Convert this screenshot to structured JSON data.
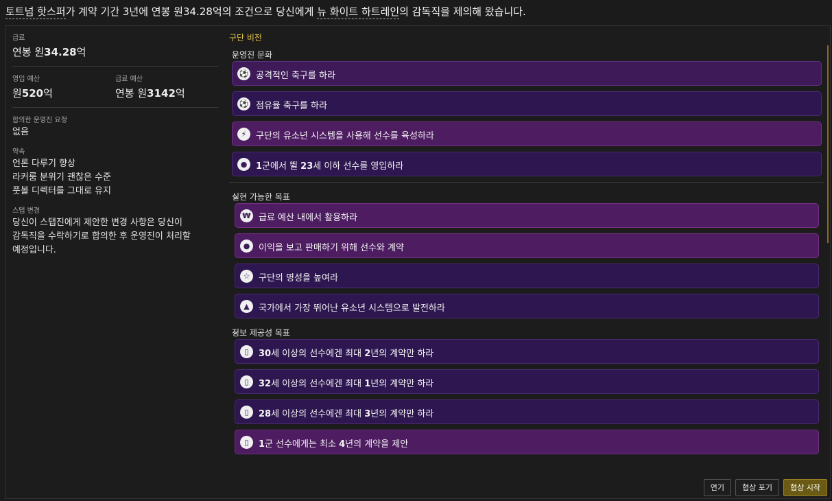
{
  "headline": {
    "club": "토트넘 핫스퍼",
    "part1": "가 계약 기간 3년에 연봉 원34.28억의 조건으로 당신에게 ",
    "team": "뉴 화이트 하트레인",
    "part2": "의 감독직을 제의해 왔습니다."
  },
  "left": {
    "salary_label": "급료",
    "salary_prefix": "연봉 원",
    "salary_value": "34.28",
    "salary_suffix": "억",
    "transfer_label": "영입 예산",
    "transfer_prefix": "원",
    "transfer_value": "520",
    "transfer_suffix": "억",
    "wage_label": "급료 예산",
    "wage_prefix": "연봉 원",
    "wage_value": "3142",
    "wage_suffix": "억",
    "board_req_label": "합의한 운영진 요청",
    "board_req_value": "없음",
    "promises_label": "약속",
    "promises": [
      "언론 다루기 향상",
      "라커룸 분위기 괜찮은 수준",
      "풋볼 디렉터를 그대로 유지"
    ],
    "staff_label": "스탭 변경",
    "staff_text_1": "당신이 스탭진에게 제안한 변경 사항은 당신이",
    "staff_text_2": "감독직을 수락하기로 합의한 후 운영진이 처리할",
    "staff_text_3": "예정입니다."
  },
  "vision": {
    "title": "구단 비전",
    "sections": [
      {
        "title": "운영진 문화",
        "items": [
          {
            "icon": "ball-icon",
            "glyph": "⚽",
            "parts": [
              "공격적인 축구를 하라"
            ]
          },
          {
            "icon": "ball-icon",
            "glyph": "⚽",
            "parts": [
              "점유율 축구를 하라"
            ]
          },
          {
            "icon": "boot-icon",
            "glyph": "⚡",
            "parts": [
              "구단의 유소년 시스템을 사용해 선수를 육성하라"
            ]
          },
          {
            "icon": "person-icon",
            "glyph": "●",
            "parts": [
              "1",
              "군에서 뛸 ",
              "23",
              "세 이하 선수를 영입하라"
            ]
          }
        ]
      },
      {
        "title": "실현 가능한 목표",
        "items": [
          {
            "icon": "money-icon",
            "glyph": "₩",
            "parts": [
              "급료 예산 내에서 활용하라"
            ]
          },
          {
            "icon": "person-icon",
            "glyph": "●",
            "parts": [
              "이익을 보고 판매하기 위해 선수와 계약"
            ]
          },
          {
            "icon": "star-icon",
            "glyph": "☆",
            "parts": [
              "구단의 명성을 높여라"
            ]
          },
          {
            "icon": "graduation-icon",
            "glyph": "▲",
            "parts": [
              "국가에서 가장 뛰어난 유소년 시스템으로 발전하라"
            ]
          }
        ]
      },
      {
        "title": "정보 제공성 목표",
        "items": [
          {
            "icon": "tablet-icon",
            "glyph": "▯",
            "parts": [
              "30",
              "세 이상의 선수에겐 최대 ",
              "2",
              "년의 계약만 하라"
            ]
          },
          {
            "icon": "tablet-icon",
            "glyph": "▯",
            "parts": [
              "32",
              "세 이상의 선수에겐 최대 ",
              "1",
              "년의 계약만 하라"
            ]
          },
          {
            "icon": "tablet-icon",
            "glyph": "▯",
            "parts": [
              "28",
              "세 이상의 선수에겐 최대 ",
              "3",
              "년의 계약만 하라"
            ]
          },
          {
            "icon": "tablet-icon",
            "glyph": "▯",
            "parts": [
              "1",
              "군 선수에게는 최소 ",
              "4",
              "년의 계약을 제안"
            ]
          }
        ]
      }
    ]
  },
  "buttons": {
    "delay": "연기",
    "abandon": "협상 포기",
    "start": "협상 시작"
  },
  "colors": {
    "accent": "#e2c44a",
    "card_purple": "#3e1a59",
    "primary_button": "#6a5a14"
  }
}
